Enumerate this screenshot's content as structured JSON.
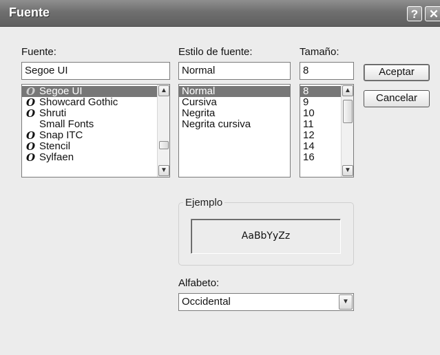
{
  "window": {
    "title": "Fuente",
    "help_label": "?",
    "close_label": "✕"
  },
  "font": {
    "label": "Fuente:",
    "value": "Segoe UI",
    "items": [
      {
        "name": "Segoe UI",
        "glyph": "O",
        "selected": true
      },
      {
        "name": "Showcard Gothic",
        "glyph": "O",
        "selected": false
      },
      {
        "name": "Shruti",
        "glyph": "O",
        "selected": false
      },
      {
        "name": "Small Fonts",
        "glyph": "",
        "selected": false
      },
      {
        "name": "Snap ITC",
        "glyph": "O",
        "selected": false
      },
      {
        "name": "Stencil",
        "glyph": "O",
        "selected": false
      },
      {
        "name": "Sylfaen",
        "glyph": "O",
        "selected": false
      }
    ]
  },
  "style": {
    "label": "Estilo de fuente:",
    "value": "Normal",
    "items": [
      "Normal",
      "Cursiva",
      "Negrita",
      "Negrita cursiva"
    ]
  },
  "size": {
    "label": "Tamaño:",
    "value": "8",
    "items": [
      "8",
      "9",
      "10",
      "11",
      "12",
      "14",
      "16"
    ]
  },
  "buttons": {
    "ok": "Aceptar",
    "cancel": "Cancelar"
  },
  "sample": {
    "group_label": "Ejemplo",
    "text": "AaBbYyZz"
  },
  "script": {
    "label": "Alfabeto:",
    "value": "Occidental"
  },
  "icons": {
    "scroll_up": "▲",
    "scroll_down": "▼",
    "dropdown": "▼"
  }
}
